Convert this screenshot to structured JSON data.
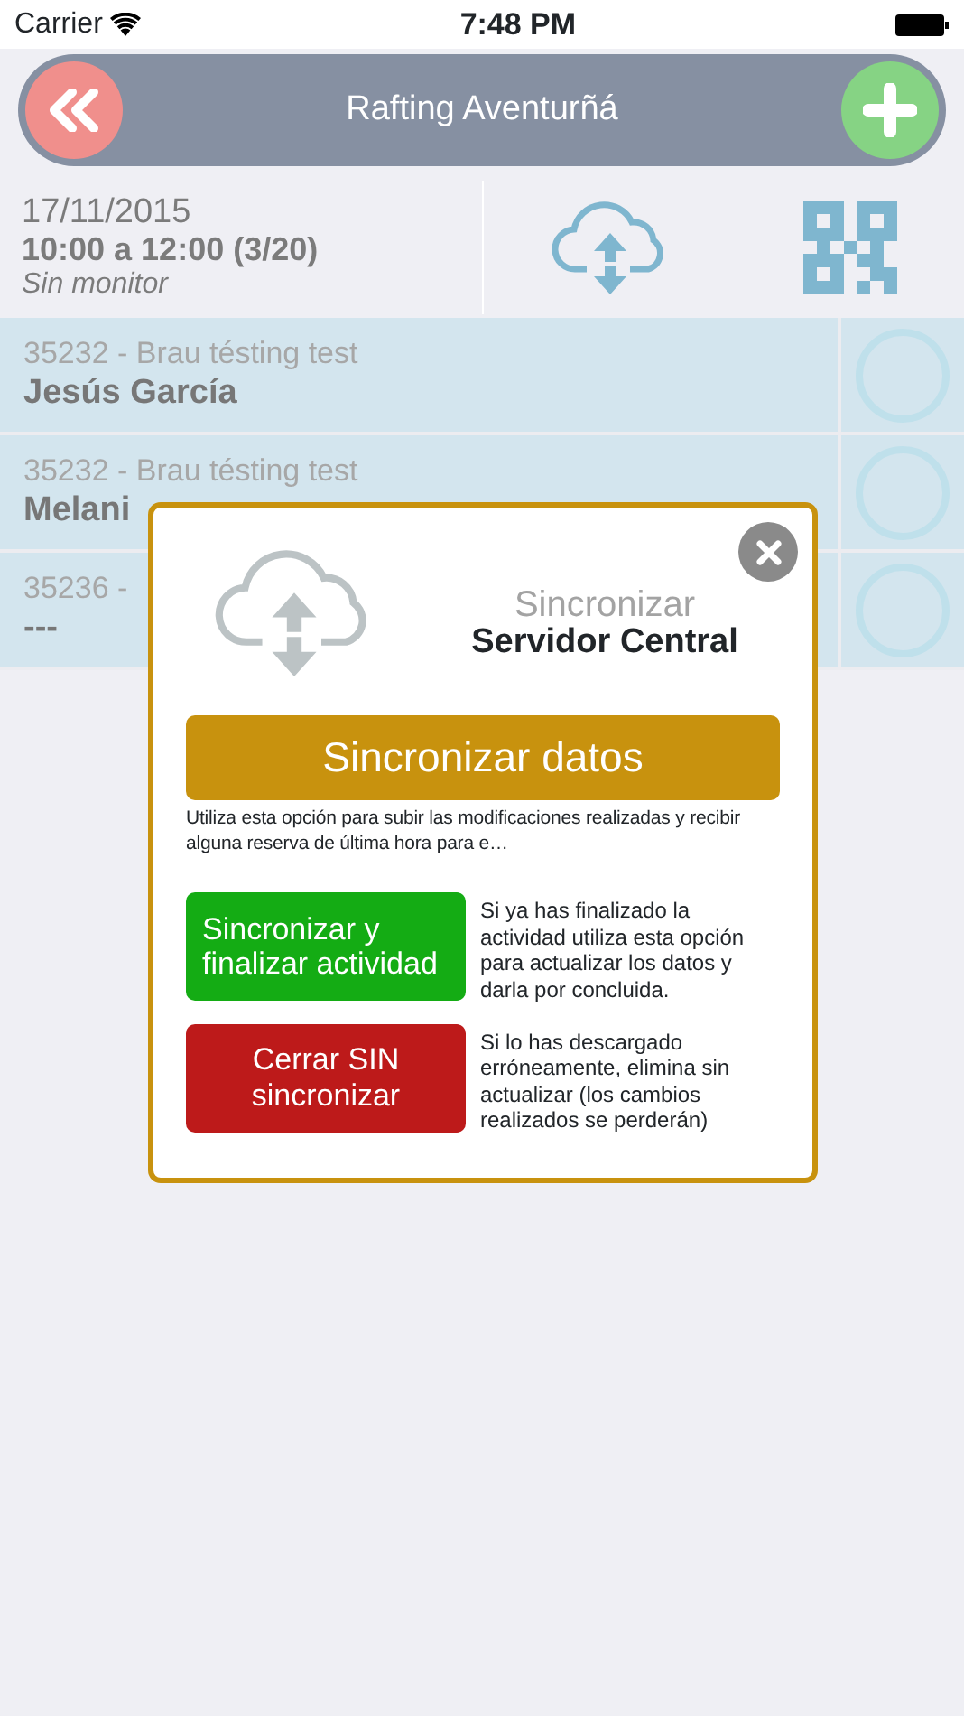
{
  "status_bar": {
    "carrier": "Carrier",
    "time": "7:48 PM"
  },
  "header": {
    "title": "Rafting Aventurñá"
  },
  "session": {
    "date": "17/11/2015",
    "time_range": "10:00 a 12:00 (3/20)",
    "monitor": "Sin monitor"
  },
  "participants": [
    {
      "booking": "35232 - Brau tésting test",
      "name": "Jesús García",
      "checked": false
    },
    {
      "booking": "35232 - Brau tésting test",
      "name": "Melani",
      "checked": false
    },
    {
      "booking": "35236 -",
      "name": "---",
      "checked": false
    }
  ],
  "dialog": {
    "subtitle": "Sincronizar",
    "title": "Servidor Central",
    "main_action": {
      "label": "Sincronizar datos",
      "description": "Utiliza esta opción para subir las modificaciones realizadas y recibir alguna reserva de última hora para e…"
    },
    "actions": [
      {
        "kind": "finish",
        "label": "Sincronizar y finalizar actividad",
        "description": "Si ya has finalizado la actividad utiliza esta opción para actualizar los datos y darla por concluida."
      },
      {
        "kind": "discard",
        "label": "Cerrar SIN sincronizar",
        "description": "Si lo has descargado erróneamente, elimina sin actualizar (los cambios realizados se perderán)"
      }
    ]
  }
}
